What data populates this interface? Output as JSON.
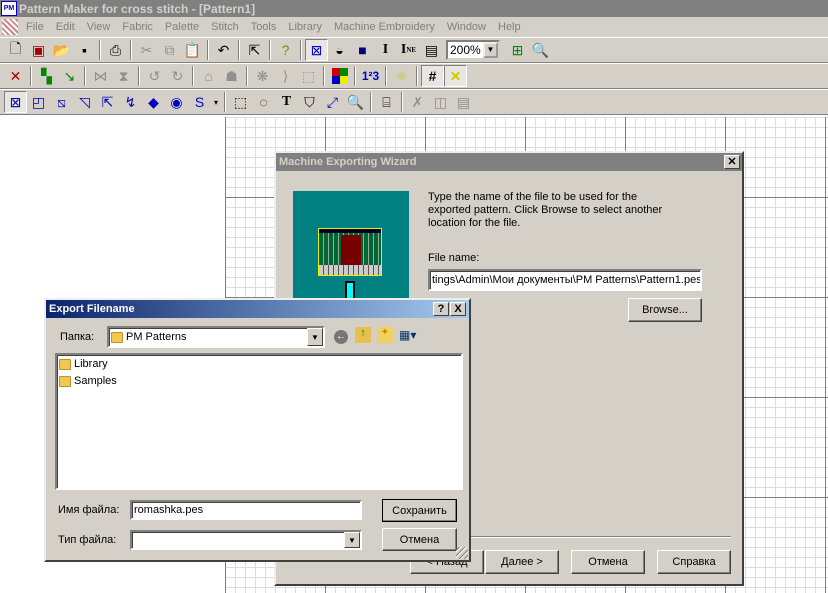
{
  "app": {
    "title": "Pattern Maker for cross stitch - [Pattern1]",
    "icon_text": "PM"
  },
  "menu": [
    "File",
    "Edit",
    "View",
    "Fabric",
    "Palette",
    "Stitch",
    "Tools",
    "Library",
    "Machine Embroidery",
    "Window",
    "Help"
  ],
  "toolbar1": {
    "icons": [
      "new-icon",
      "open-template-icon",
      "open-icon",
      "save-icon",
      "print-icon",
      "cut-icon",
      "copy-icon",
      "paste-icon",
      "undo-icon",
      "import-icon",
      "help-icon",
      "cross-stitch-view-icon",
      "symbol-view-icon",
      "color-view-icon",
      "I",
      "I-ne",
      "page-icon"
    ],
    "zoom": "200%"
  },
  "toolbar2": {
    "icons": [
      "delete-icon",
      "replace-color-icon",
      "replace-stitch-icon",
      "flip-horizontal-icon",
      "flip-vertical-icon",
      "rotate-left-icon",
      "rotate-right-icon",
      "outline-icon",
      "fill-icon",
      "mirror-icon",
      "half-mirror-icon",
      "select-area-icon",
      "palette-icon",
      "numbering-icon",
      "sparkle-icon",
      "grid-icon",
      "cross-icon"
    ]
  },
  "toolbar3": {
    "icons": [
      "full-stitch-icon",
      "quarter-stitch-icon",
      "half-stitch-icon",
      "three-quarter-stitch-icon",
      "petite-stitch-icon",
      "backstitch-icon",
      "french-knot-icon",
      "bead-icon",
      "s-icon",
      "rect-select-icon",
      "lasso-select-icon",
      "text-icon",
      "fill-bucket-icon",
      "eyedropper-icon",
      "magnifier-icon",
      "machine-icon",
      "stitch-icon",
      "columns-icon",
      "page-icon"
    ]
  },
  "wizard": {
    "title": "Machine Exporting Wizard",
    "description": "Type the name of the file to be used for the exported pattern.  Click Browse to select another location for the file.",
    "file_name_label": "File name:",
    "file_name_value": "tings\\Admin\\Мои документы\\PM Patterns\\Pattern1.pes",
    "browse": "Browse...",
    "back": "< Назад",
    "next": "Далее >",
    "cancel": "Отмена",
    "help": "Справка"
  },
  "export": {
    "title": "Export Filename",
    "folder_label": "Папка:",
    "folder": "PM Patterns",
    "items": [
      "Library",
      "Samples"
    ],
    "filename_label": "Имя файла:",
    "filename_value": "romashka.pes",
    "filetype_label": "Тип файла:",
    "filetype_value": "",
    "save": "Сохранить",
    "cancel": "Отмена",
    "help_btn": "?",
    "close_btn": "X"
  }
}
